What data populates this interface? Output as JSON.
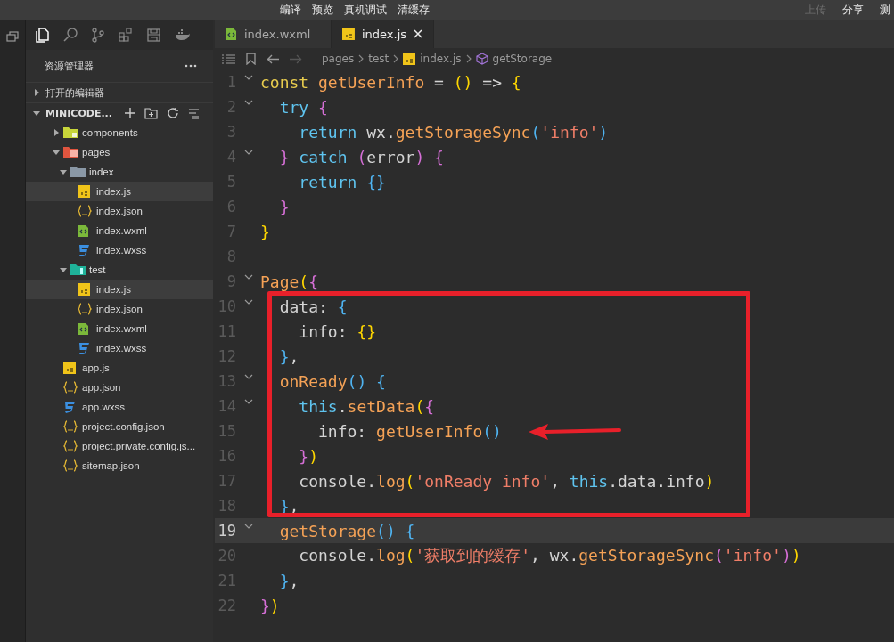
{
  "toolbar": {
    "items": [
      {
        "label": "编译",
        "disabled": false
      },
      {
        "label": "预览",
        "disabled": false
      },
      {
        "label": "真机调试",
        "disabled": false
      },
      {
        "label": "清缓存",
        "disabled": false
      }
    ],
    "right_items": [
      {
        "label": "上传",
        "disabled": true
      },
      {
        "label": "分享",
        "disabled": false
      },
      {
        "label": "测",
        "disabled": false
      }
    ]
  },
  "sidebar": {
    "title": "资源管理器",
    "open_editors": {
      "label": "打开的编辑器",
      "expanded": false
    },
    "project": {
      "label": "MINICODE...",
      "expanded": true
    },
    "tree": [
      {
        "label": "components",
        "kind": "folder-components",
        "expanded": false,
        "selected": false
      },
      {
        "label": "pages",
        "kind": "folder-pages",
        "expanded": true,
        "selected": false,
        "children": [
          {
            "label": "index",
            "kind": "folder",
            "expanded": true,
            "selected": false,
            "children": [
              {
                "label": "index.js",
                "kind": "js",
                "selected": true
              },
              {
                "label": "index.json",
                "kind": "json",
                "selected": false
              },
              {
                "label": "index.wxml",
                "kind": "wxml",
                "selected": false
              },
              {
                "label": "index.wxss",
                "kind": "wxss",
                "selected": false
              }
            ]
          },
          {
            "label": "test",
            "kind": "folder-test",
            "expanded": true,
            "selected": false,
            "children": [
              {
                "label": "index.js",
                "kind": "js",
                "selected": true
              },
              {
                "label": "index.json",
                "kind": "json",
                "selected": false
              },
              {
                "label": "index.wxml",
                "kind": "wxml",
                "selected": false
              },
              {
                "label": "index.wxss",
                "kind": "wxss",
                "selected": false
              }
            ]
          }
        ]
      },
      {
        "label": "app.js",
        "kind": "js",
        "selected": false
      },
      {
        "label": "app.json",
        "kind": "json",
        "selected": false
      },
      {
        "label": "app.wxss",
        "kind": "wxss",
        "selected": false
      },
      {
        "label": "project.config.json",
        "kind": "json",
        "selected": false
      },
      {
        "label": "project.private.config.js...",
        "kind": "json",
        "selected": false
      },
      {
        "label": "sitemap.json",
        "kind": "json",
        "selected": false
      }
    ]
  },
  "tabs": [
    {
      "label": "index.wxml",
      "kind": "wxml",
      "selected": false
    },
    {
      "label": "index.js",
      "kind": "js",
      "selected": true
    }
  ],
  "breadcrumb": [
    {
      "label": "pages",
      "kind": "folder"
    },
    {
      "label": "test",
      "kind": "folder"
    },
    {
      "label": "index.js",
      "kind": "js"
    },
    {
      "label": "getStorage",
      "kind": "symbol"
    }
  ],
  "code": [
    {
      "number": "1",
      "foldable": true,
      "current": false,
      "tokens": [
        {
          "text": "const ",
          "kind": "keyword"
        },
        {
          "text": "getUserInfo",
          "kind": "function"
        },
        {
          "text": " = ",
          "kind": "plain"
        },
        {
          "text": "()",
          "kind": "bracket1"
        },
        {
          "text": " => ",
          "kind": "plain"
        },
        {
          "text": "{",
          "kind": "bracket1"
        }
      ]
    },
    {
      "number": "2",
      "foldable": true,
      "current": false,
      "tokens": [
        {
          "text": "  try ",
          "kind": "control"
        },
        {
          "text": "{",
          "kind": "bracket2"
        }
      ]
    },
    {
      "number": "3",
      "foldable": false,
      "current": false,
      "tokens": [
        {
          "text": "    return",
          "kind": "control"
        },
        {
          "text": " wx.",
          "kind": "plain"
        },
        {
          "text": "getStorageSync",
          "kind": "function"
        },
        {
          "text": "(",
          "kind": "bracket3"
        },
        {
          "text": "'info'",
          "kind": "string"
        },
        {
          "text": ")",
          "kind": "bracket3"
        }
      ]
    },
    {
      "number": "4",
      "foldable": true,
      "current": false,
      "tokens": [
        {
          "text": "  }",
          "kind": "bracket2"
        },
        {
          "text": " catch ",
          "kind": "control"
        },
        {
          "text": "(",
          "kind": "bracket2"
        },
        {
          "text": "error",
          "kind": "plain"
        },
        {
          "text": ") {",
          "kind": "bracket2"
        }
      ]
    },
    {
      "number": "5",
      "foldable": false,
      "current": false,
      "tokens": [
        {
          "text": "    return ",
          "kind": "control"
        },
        {
          "text": "{}",
          "kind": "bracket3"
        }
      ]
    },
    {
      "number": "6",
      "foldable": false,
      "current": false,
      "tokens": [
        {
          "text": "  }",
          "kind": "bracket2"
        }
      ]
    },
    {
      "number": "7",
      "foldable": false,
      "current": false,
      "tokens": [
        {
          "text": "}",
          "kind": "bracket1"
        }
      ]
    },
    {
      "number": "8",
      "foldable": false,
      "current": false
    },
    {
      "number": "9",
      "foldable": true,
      "current": false,
      "tokens": [
        {
          "text": "Page",
          "kind": "function"
        },
        {
          "text": "(",
          "kind": "bracket1"
        },
        {
          "text": "{",
          "kind": "bracket2"
        }
      ]
    },
    {
      "number": "10",
      "foldable": true,
      "current": false,
      "tokens": [
        {
          "text": "  data: ",
          "kind": "plain"
        },
        {
          "text": "{",
          "kind": "bracket3"
        }
      ]
    },
    {
      "number": "11",
      "foldable": false,
      "current": false,
      "tokens": [
        {
          "text": "    info: ",
          "kind": "plain"
        },
        {
          "text": "{}",
          "kind": "bracket1"
        }
      ]
    },
    {
      "number": "12",
      "foldable": false,
      "current": false,
      "tokens": [
        {
          "text": "  }",
          "kind": "bracket3"
        },
        {
          "text": ",",
          "kind": "plain"
        }
      ]
    },
    {
      "number": "13",
      "foldable": true,
      "current": false,
      "tokens": [
        {
          "text": "  onReady",
          "kind": "function"
        },
        {
          "text": "() {",
          "kind": "bracket3"
        }
      ]
    },
    {
      "number": "14",
      "foldable": true,
      "current": false,
      "tokens": [
        {
          "text": "    this",
          "kind": "control"
        },
        {
          "text": ".",
          "kind": "plain"
        },
        {
          "text": "setData",
          "kind": "function"
        },
        {
          "text": "(",
          "kind": "bracket1"
        },
        {
          "text": "{",
          "kind": "bracket2"
        }
      ]
    },
    {
      "number": "15",
      "foldable": false,
      "current": false,
      "tokens": [
        {
          "text": "      info: ",
          "kind": "plain"
        },
        {
          "text": "getUserInfo",
          "kind": "function"
        },
        {
          "text": "()",
          "kind": "bracket3"
        }
      ]
    },
    {
      "number": "16",
      "foldable": false,
      "current": false,
      "tokens": [
        {
          "text": "    }",
          "kind": "bracket2"
        },
        {
          "text": ")",
          "kind": "bracket1"
        }
      ]
    },
    {
      "number": "17",
      "foldable": false,
      "current": false,
      "tokens": [
        {
          "text": "    console.",
          "kind": "plain"
        },
        {
          "text": "log",
          "kind": "function"
        },
        {
          "text": "(",
          "kind": "bracket1"
        },
        {
          "text": "'onReady info'",
          "kind": "string"
        },
        {
          "text": ", ",
          "kind": "plain"
        },
        {
          "text": "this",
          "kind": "control"
        },
        {
          "text": ".data.info",
          "kind": "plain"
        },
        {
          "text": ")",
          "kind": "bracket1"
        }
      ]
    },
    {
      "number": "18",
      "foldable": false,
      "current": false,
      "tokens": [
        {
          "text": "  }",
          "kind": "bracket3"
        },
        {
          "text": ",",
          "kind": "plain"
        }
      ]
    },
    {
      "number": "19",
      "foldable": true,
      "current": true,
      "tokens": [
        {
          "text": "  getStorage",
          "kind": "function"
        },
        {
          "text": "() {",
          "kind": "bracket3"
        }
      ]
    },
    {
      "number": "20",
      "foldable": false,
      "current": false,
      "tokens": [
        {
          "text": "    console.",
          "kind": "plain"
        },
        {
          "text": "log",
          "kind": "function"
        },
        {
          "text": "(",
          "kind": "bracket1"
        },
        {
          "text": "'获取到的缓存'",
          "kind": "string"
        },
        {
          "text": ", wx.",
          "kind": "plain"
        },
        {
          "text": "getStorageSync",
          "kind": "function"
        },
        {
          "text": "(",
          "kind": "bracket2"
        },
        {
          "text": "'info'",
          "kind": "string"
        },
        {
          "text": ")",
          "kind": "bracket2"
        },
        {
          "text": ")",
          "kind": "bracket1"
        }
      ]
    },
    {
      "number": "21",
      "foldable": false,
      "current": false,
      "tokens": [
        {
          "text": "  }",
          "kind": "bracket3"
        },
        {
          "text": ",",
          "kind": "plain"
        }
      ]
    },
    {
      "number": "22",
      "foldable": false,
      "current": false,
      "tokens": [
        {
          "text": "}",
          "kind": "bracket2"
        },
        {
          "text": ")",
          "kind": "bracket1"
        }
      ]
    }
  ]
}
